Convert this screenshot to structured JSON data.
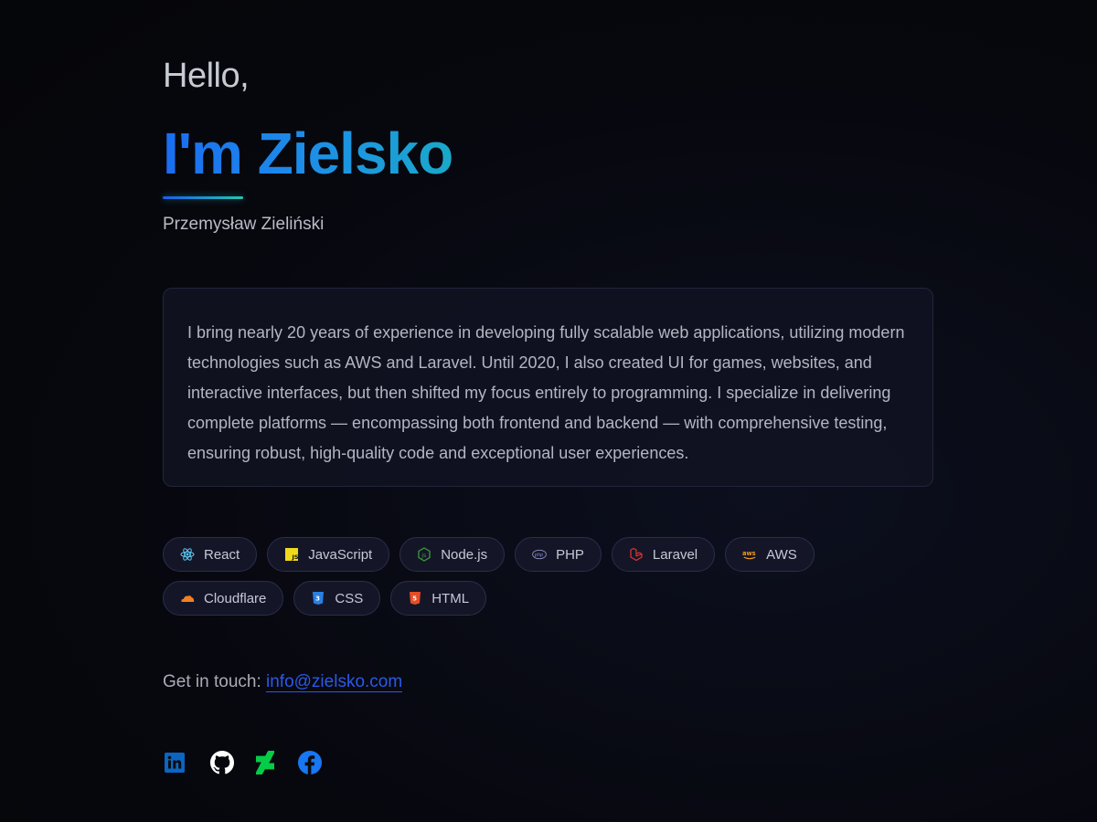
{
  "hero": {
    "greeting": "Hello,",
    "title": "I'm Zielsko",
    "full_name": "Przemysław Zieliński"
  },
  "bio": {
    "text": "I bring nearly 20 years of experience in developing fully scalable web applications, utilizing modern technologies such as AWS and Laravel. Until 2020, I also created UI for games, websites, and interactive interfaces, but then shifted my focus entirely to programming. I specialize in delivering complete platforms — encompassing both frontend and backend — with comprehensive testing, ensuring robust, high-quality code and exceptional user experiences."
  },
  "skills": [
    {
      "label": "React",
      "icon": "react-icon",
      "color": "#5ac8f0"
    },
    {
      "label": "JavaScript",
      "icon": "javascript-icon",
      "color": "#f0d91c"
    },
    {
      "label": "Node.js",
      "icon": "nodejs-icon",
      "color": "#3f9a3c"
    },
    {
      "label": "PHP",
      "icon": "php-icon",
      "color": "#8b8fc7"
    },
    {
      "label": "Laravel",
      "icon": "laravel-icon",
      "color": "#e3342f"
    },
    {
      "label": "AWS",
      "icon": "aws-icon",
      "color": "#f49a1c"
    },
    {
      "label": "Cloudflare",
      "icon": "cloudflare-icon",
      "color": "#f38020"
    },
    {
      "label": "CSS",
      "icon": "css-icon",
      "color": "#2b7fe0"
    },
    {
      "label": "HTML",
      "icon": "html-icon",
      "color": "#e44d26"
    }
  ],
  "contact": {
    "prefix": "Get in touch:",
    "email": "info@zielsko.com"
  },
  "social": [
    {
      "name": "linkedin-icon",
      "color": "#0a66c2"
    },
    {
      "name": "github-icon",
      "color": "#ffffff"
    },
    {
      "name": "deviantart-icon",
      "color": "#05cc47"
    },
    {
      "name": "facebook-icon",
      "color": "#1877f2"
    }
  ],
  "colors": {
    "accent": "#1a6cf0",
    "accent_2": "#22c7b0",
    "link": "#2b59e8"
  }
}
